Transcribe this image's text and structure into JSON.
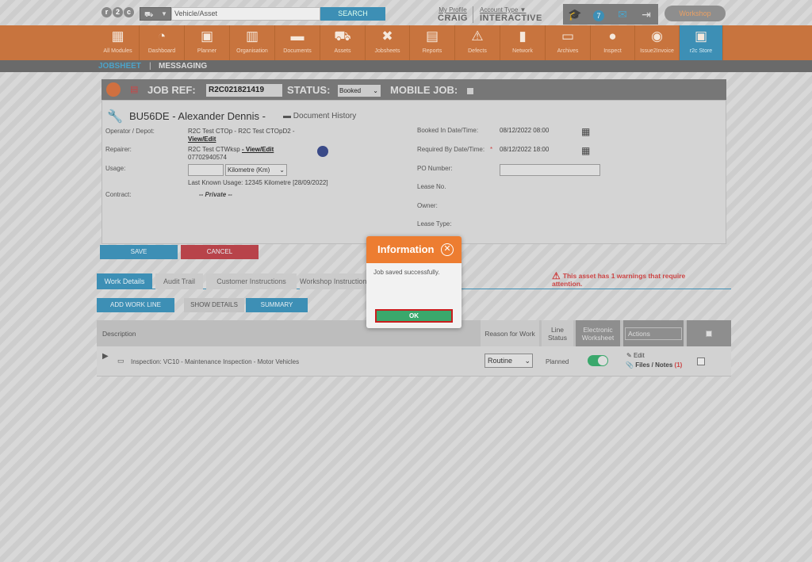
{
  "topbar": {
    "logo": "r2c",
    "vehicle_placeholder": "Vehicle/Asset",
    "search_label": "SEARCH",
    "my_profile_label": "My Profile",
    "user_name": "CRAIG",
    "account_type_label": "Account Type",
    "account_type": "INTERACTIVE",
    "notification_count": "7",
    "workshop_label": "Workshop"
  },
  "nav": [
    {
      "label": "All Modules",
      "icon": "grid-icon"
    },
    {
      "label": "Dashboard",
      "icon": "gauge-icon"
    },
    {
      "label": "Planner",
      "icon": "calendar-icon"
    },
    {
      "label": "Organisation",
      "icon": "building-icon"
    },
    {
      "label": "Documents",
      "icon": "folder-icon"
    },
    {
      "label": "Assets",
      "icon": "truck-icon"
    },
    {
      "label": "Jobsheets",
      "icon": "tools-icon"
    },
    {
      "label": "Reports",
      "icon": "clipboard-icon"
    },
    {
      "label": "Defects",
      "icon": "warning-icon"
    },
    {
      "label": "Network",
      "icon": "contacts-icon"
    },
    {
      "label": "Archives",
      "icon": "archive-icon"
    },
    {
      "label": "Inspect",
      "icon": "inspect-icon"
    },
    {
      "label": "Issue2Invoice",
      "icon": "invoice-icon"
    },
    {
      "label": "r2c Store",
      "icon": "bag-icon"
    }
  ],
  "subnav": {
    "jobsheet": "JOBSHEET",
    "separator": "|",
    "messaging": "MESSAGING"
  },
  "job": {
    "ref_label": "JOB REF:",
    "ref_value": "R2C021821419",
    "status_label": "STATUS:",
    "status_value": "Booked",
    "mobile_label": "MOBILE JOB:",
    "vehicle_title": "BU56DE  -  Alexander Dennis  -",
    "doc_history": "Document History",
    "operator_label": "Operator / Depot:",
    "operator_value": "R2C Test CTOp - R2C Test CTOpD2 -",
    "view_edit": "View/Edit",
    "repairer_label": "Repairer:",
    "repairer_value": "R2C Test CTWksp",
    "repairer_link": "- View/Edit",
    "repairer_phone": "07702940574",
    "usage_label": "Usage:",
    "usage_unit": "Kilometre (Km)",
    "last_usage": "Last Known Usage: 12345 Kilometre [28/09/2022]",
    "contract_label": "Contract:",
    "contract_value": "-- Private --",
    "booked_label": "Booked In Date/Time:",
    "booked_value": "08/12/2022 08:00",
    "required_label": "Required By Date/Time:",
    "required_star": "*",
    "required_value": "08/12/2022 18:00",
    "po_label": "PO Number:",
    "lease_no_label": "Lease No.",
    "owner_label": "Owner:",
    "lease_type_label": "Lease Type:",
    "save": "SAVE",
    "cancel": "CANCEL"
  },
  "tabs": [
    "Work Details",
    "Audit Trail",
    "Customer Instructions",
    "Workshop Instructions"
  ],
  "warning": "This asset has 1 warnings that require attention.",
  "actions": {
    "add": "ADD WORK LINE",
    "details": "SHOW DETAILS",
    "summary": "SUMMARY"
  },
  "table": {
    "headers": {
      "description": "Description",
      "reason": "Reason for Work",
      "status": "Line Status",
      "worksheet": "Electronic Worksheet",
      "actions": "Actions"
    },
    "row": {
      "description": "Inspection: VC10 - Maintenance Inspection - Motor Vehicles",
      "reason": "Routine",
      "status": "Planned",
      "edit": "Edit",
      "files": "Files / Notes",
      "files_count": "(1)"
    }
  },
  "dialog": {
    "title": "Information",
    "message": "Job saved successfully.",
    "ok": "OK"
  }
}
